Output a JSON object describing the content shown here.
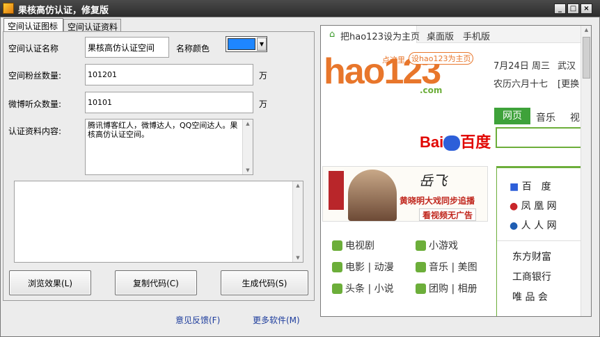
{
  "window": {
    "title": "果核高仿认证，修复版",
    "controls": [
      "_",
      "□",
      "×"
    ]
  },
  "tabs": [
    "空间认证图标",
    "空间认证资料"
  ],
  "form": {
    "name_label": "空间认证名称",
    "name_value": "果核高仿认证空间",
    "color_label": "名称颜色",
    "color_value": "#1e86ff",
    "fans_label": "空间粉丝数量:",
    "fans_value": "101201",
    "fans_unit": "万",
    "weibo_label": "微博听众数量:",
    "weibo_value": "10101",
    "weibo_unit": "万",
    "info_label": "认证资料内容:",
    "info_value": "腾讯博客红人，微博达人，QQ空间达人。果核高仿认证空间。",
    "code_value": ""
  },
  "buttons": {
    "preview": "浏览效果(L)",
    "copy": "复制代码(C)",
    "generate": "生成代码(S)"
  },
  "links": {
    "feedback": "意见反馈(F)",
    "more": "更多软件(M)"
  },
  "browser": {
    "set_home": "把hao123设为主页",
    "desktop": "桌面版",
    "mobile": "手机版",
    "logo": "hao123",
    "logo_suffix": ".com",
    "bubble": "点这里",
    "bubble_box": "设hao123为主页",
    "date": "7月24日 周三",
    "city": "武汉",
    "lunar": "农历六月十七",
    "change": "[更换",
    "search_tabs": [
      "网页",
      "音乐",
      "视"
    ],
    "baidu": "百度",
    "banner_name": "岳飞",
    "banner_text": "黄晓明大戏同步追播",
    "banner_sub": "看视频无广告",
    "services": [
      [
        "电视剧",
        "小游戏"
      ],
      [
        "电影 | 动漫",
        "音乐 | 美图"
      ],
      [
        "头条 | 小说",
        "团购 | 相册"
      ]
    ],
    "sites": [
      "百　度",
      "凤 凰 网",
      "人 人 网"
    ],
    "sites2": [
      "东方财富",
      "工商银行",
      "唯 品 会"
    ]
  }
}
